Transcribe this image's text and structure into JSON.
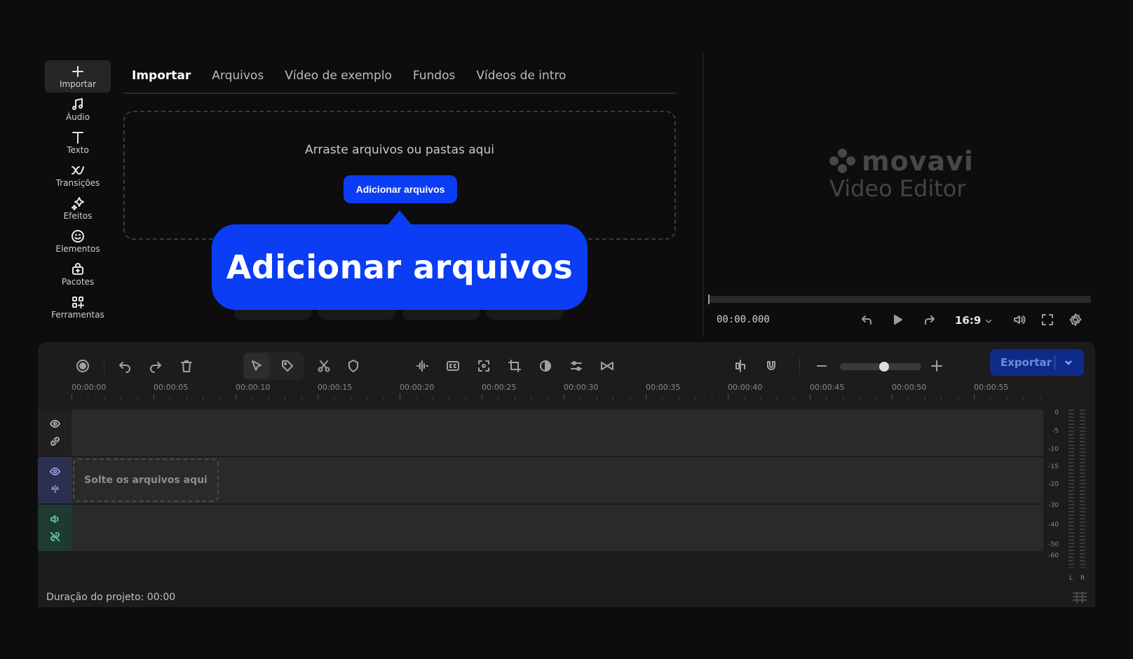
{
  "sidebar": {
    "items": [
      {
        "label": "Importar",
        "icon": "plus-icon"
      },
      {
        "label": "Áudio",
        "icon": "music-note-icon"
      },
      {
        "label": "Texto",
        "icon": "text-t-icon"
      },
      {
        "label": "Transições",
        "icon": "bowtie-icon"
      },
      {
        "label": "Efeitos",
        "icon": "sparkle-icon"
      },
      {
        "label": "Elementos",
        "icon": "smiley-icon"
      },
      {
        "label": "Pacotes",
        "icon": "bag-plus-icon"
      },
      {
        "label": "Ferramentas",
        "icon": "grid-plus-icon"
      }
    ]
  },
  "import": {
    "tabs": [
      "Importar",
      "Arquivos",
      "Vídeo de exemplo",
      "Fundos",
      "Vídeos de intro"
    ],
    "drop_text": "Arraste arquivos ou pastas aqui",
    "add_button": "Adicionar arquivos"
  },
  "callout": {
    "text": "Adicionar arquivos",
    "color": "#0b3df5"
  },
  "preview": {
    "logo_name": "movavi",
    "logo_sub": "Video Editor",
    "timecode": "00:00.000",
    "aspect_ratio": "16:9"
  },
  "timeline": {
    "export_label": "Exportar",
    "ruler": [
      "00:00:00",
      "00:00:05",
      "00:00:10",
      "00:00:15",
      "00:00:20",
      "00:00:25",
      "00:00:30",
      "00:00:35",
      "00:00:40",
      "00:00:45",
      "00:00:50",
      "00:00:55"
    ],
    "drop_clip": "Solte os arquivos aqui",
    "vu_labels": [
      "0",
      "-5",
      "-10",
      "-15",
      "-20",
      "-30",
      "-40",
      "-50",
      "-60"
    ],
    "vu_channels": [
      "L",
      "R"
    ],
    "duration": "Duração do projeto: 00:00",
    "zoom_level": 0.55
  },
  "colors": {
    "accent": "#0b3df5",
    "export_bg": "#0f2b8a",
    "video_track": "#2c3050",
    "audio_track": "#1f3a32"
  }
}
